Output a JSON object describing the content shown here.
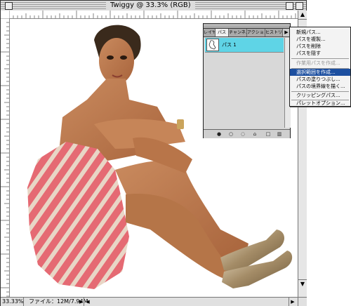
{
  "window": {
    "title": "Twiggy @ 33.3% (RGB)"
  },
  "status": {
    "zoom": "33.33%",
    "file_info": "ファイル：12M/7.94M",
    "arrow": "▶"
  },
  "scroll": {
    "up": "▲",
    "down": "▼",
    "left": "◀",
    "right": "▶"
  },
  "palette": {
    "tabs": [
      "レイヤー",
      "パス",
      "チャンネル",
      "アクション",
      "ヒストリー"
    ],
    "menu_button": "▶",
    "paths": [
      {
        "name": "パス 1"
      }
    ],
    "footer_icons": [
      "fill-path-icon",
      "stroke-path-icon",
      "load-selection-icon",
      "make-path-icon",
      "new-path-icon",
      "trash-icon"
    ]
  },
  "menu": {
    "items": [
      {
        "label": "新規パス..."
      },
      {
        "label": "パスを複製..."
      },
      {
        "label": "パスを削除"
      },
      {
        "label": "パスを隠す"
      },
      {
        "label": "作業用パスを作成...",
        "disabled": true
      },
      {
        "label": "選択範囲を作成...",
        "highlighted": true
      },
      {
        "label": "パスの塗りつぶし..."
      },
      {
        "label": "パスの境界線を描く..."
      },
      {
        "label": "クリッピングパス..."
      },
      {
        "label": "パレットオプション..."
      }
    ]
  },
  "colors": {
    "highlight": "#1c4fa0",
    "path_row": "#5fd4e6"
  }
}
